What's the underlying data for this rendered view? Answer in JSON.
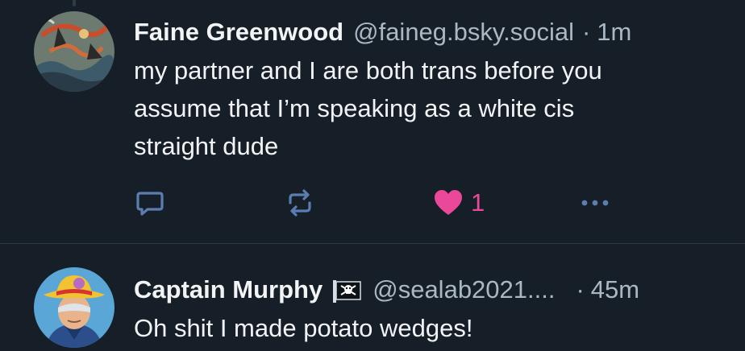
{
  "posts": [
    {
      "author": {
        "display_name": "Faine Greenwood",
        "handle": "@faineg.bsky.social",
        "avatar": "dragon-painting-avatar"
      },
      "separator": "·",
      "time": "1m",
      "text_lines": [
        "my partner and I are both trans before you",
        "assume that I’m speaking as a white cis",
        "straight dude"
      ],
      "actions": {
        "reply_icon": "reply-icon",
        "repost_icon": "repost-icon",
        "like_icon": "heart-filled-icon",
        "like_count": "1",
        "more_icon": "more-horizontal-icon"
      }
    },
    {
      "author": {
        "display_name": "Captain Murphy",
        "handle": "@sealab2021....",
        "avatar": "cartoon-captain-avatar",
        "badge_icon": "pirate-flag-icon"
      },
      "separator": "·",
      "time": "45m",
      "text": "Oh shit I made potato wedges!"
    }
  ],
  "colors": {
    "background": "#161e27",
    "divider": "#2b3642",
    "primary_text": "#f1f3f5",
    "secondary_text": "#aab8c6",
    "action_icon": "#5c7db0",
    "like": "#ec4899"
  }
}
